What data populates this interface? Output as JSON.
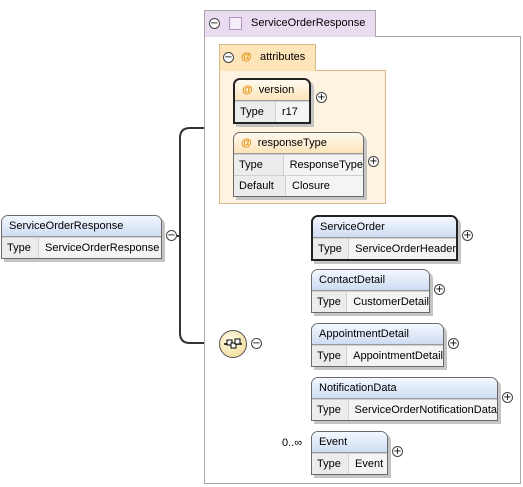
{
  "complex_type": {
    "name": "ServiceOrderResponse"
  },
  "attributes_group": {
    "label": "attributes"
  },
  "root_element": {
    "name": "ServiceOrderResponse",
    "type_label": "Type",
    "type": "ServiceOrderResponse"
  },
  "attributes": [
    {
      "name": "version",
      "rows": [
        {
          "key": "Type",
          "value": "r17"
        }
      ]
    },
    {
      "name": "responseType",
      "rows": [
        {
          "key": "Type",
          "value": "ResponseType"
        },
        {
          "key": "Default",
          "value": "Closure"
        }
      ]
    }
  ],
  "sequence": {
    "occurs_label": "0..∞",
    "children": [
      {
        "name": "ServiceOrder",
        "type_label": "Type",
        "type": "ServiceOrderHeader",
        "required": true
      },
      {
        "name": "ContactDetail",
        "type_label": "Type",
        "type": "CustomerDetail",
        "required": false
      },
      {
        "name": "AppointmentDetail",
        "type_label": "Type",
        "type": "AppointmentDetail",
        "required": false
      },
      {
        "name": "NotificationData",
        "type_label": "Type",
        "type": "ServiceOrderNotificationData",
        "required": false
      },
      {
        "name": "Event",
        "type_label": "Type",
        "type": "Event",
        "required": false
      }
    ]
  },
  "toggles": {
    "collapse": "−",
    "expand": "+"
  },
  "attribute_marker": "@"
}
